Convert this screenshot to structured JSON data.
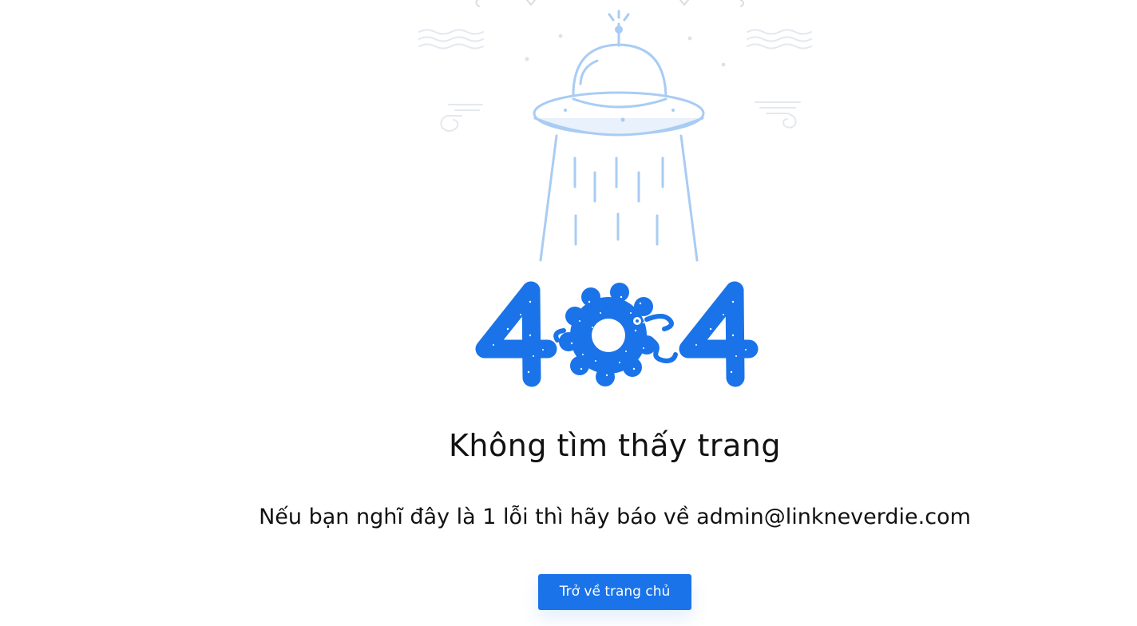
{
  "illustration": {
    "ufo_icon": "ufo-icon",
    "error_code": "404",
    "primary_color": "#1a73e8",
    "line_color": "#a9ccf3"
  },
  "content": {
    "title": "Không tìm thấy trang",
    "message": "Nếu bạn nghĩ đây là 1 lỗi thì hãy báo về admin@linkneverdie.com"
  },
  "actions": {
    "home_button_label": "Trở về trang chủ"
  }
}
